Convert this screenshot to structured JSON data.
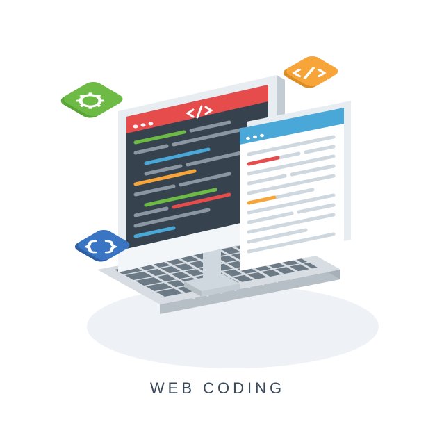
{
  "caption": "WEB CODING",
  "icons": {
    "gear": "gear-icon",
    "code": "code-icon",
    "braces": "braces-icon"
  },
  "colors": {
    "green": "#6dbb45",
    "orange": "#f7a438",
    "blue": "#3a75c4",
    "cyan": "#4aa8d8",
    "red": "#e74c4c",
    "dark": "#36434f",
    "darker": "#2b3640",
    "grey": "#cfd8df",
    "lightgrey": "#e8edf1",
    "white": "#ffffff",
    "paper": "#f3f6f9",
    "keyboard": "#d7dde2",
    "keyboardSide": "#b7bfc6",
    "keyCap": "#6c7a86",
    "shadow": "#e6ecf1"
  }
}
